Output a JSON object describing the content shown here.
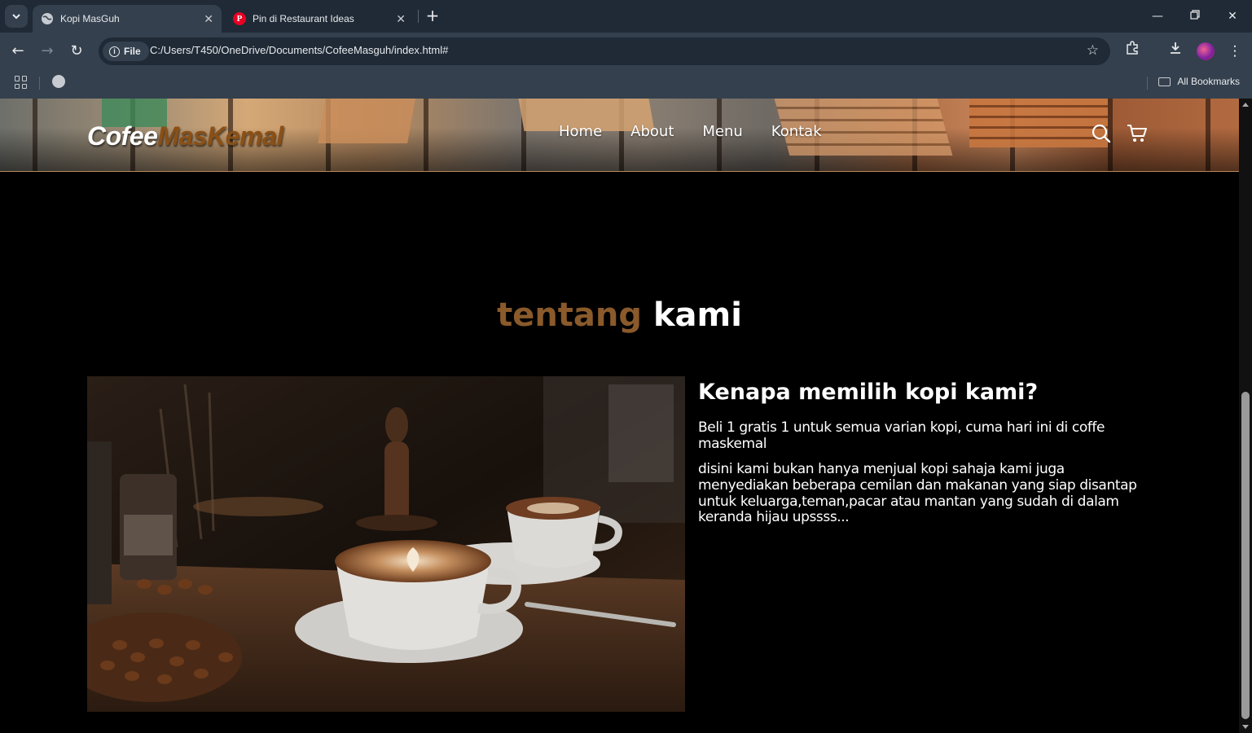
{
  "browser": {
    "tabs": [
      {
        "title": "Kopi MasGuh",
        "active": true,
        "icon": "globe-icon"
      },
      {
        "title": "Pin di Restaurant Ideas",
        "active": false,
        "icon": "pinterest-icon"
      }
    ],
    "address": {
      "scheme_chip": "File",
      "url": "C:/Users/T450/OneDrive/Documents/CofeeMasguh/index.html#"
    },
    "bookmarks_bar": {
      "all_bookmarks_label": "All Bookmarks"
    }
  },
  "site": {
    "brand": {
      "part1": "Cofee",
      "part2": "MasKemal"
    },
    "nav": [
      {
        "label": "Home"
      },
      {
        "label": "About"
      },
      {
        "label": "Menu"
      },
      {
        "label": "Kontak"
      }
    ],
    "nav_icons": [
      "search-icon",
      "cart-icon"
    ],
    "colors": {
      "accent_brown": "#8a5a2b",
      "background": "#000000",
      "nav_border": "#b6895b"
    }
  },
  "about": {
    "title_accent": "tentang",
    "title_plain": "kami",
    "heading": "Kenapa memilih kopi kami?",
    "paragraph1": "Beli 1 gratis 1 untuk semua varian kopi, cuma hari ini di coffe maskemal",
    "paragraph2": "disini kami bukan hanya menjual kopi sahaja kami juga menyediakan beberapa cemilan dan makanan yang siap disantap untuk keluarga,teman,pacar atau mantan yang sudah di dalam keranda hijau upssss..."
  }
}
